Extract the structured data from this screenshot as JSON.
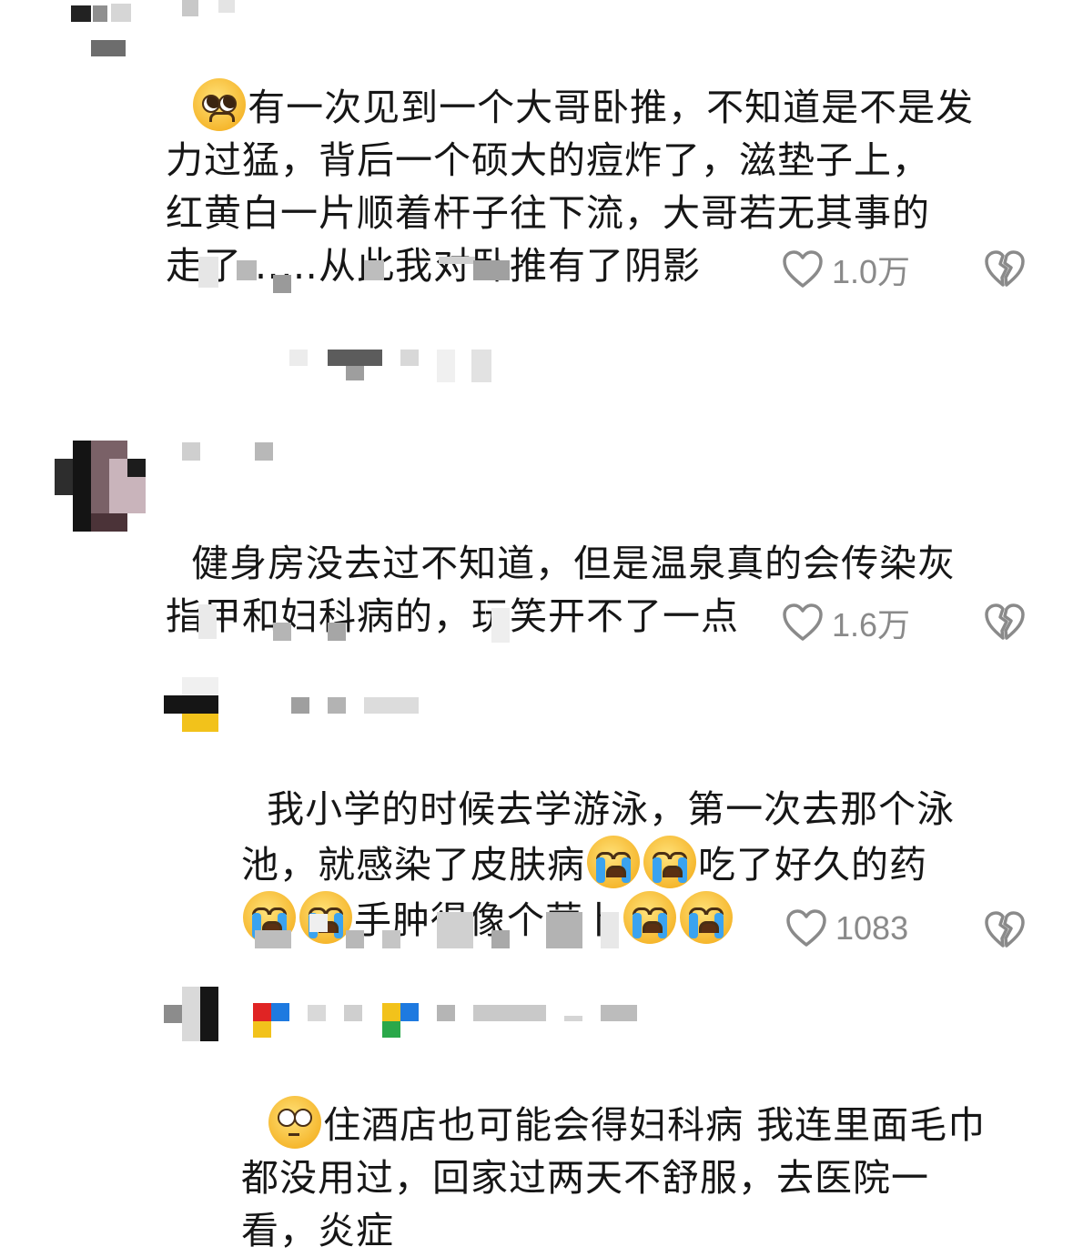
{
  "comments": [
    {
      "text_parts": [
        "有一次见到一个大哥卧推，不知道是不是发",
        "力过猛，背后一个硕大的痘炸了，滋垫子上，",
        "红黄白一片顺着杆子往下流，大哥若无其事的",
        "走了……从此我对卧推有了阴影"
      ],
      "leading_emoji": "pleading-face-icon",
      "likes": "1.0万"
    },
    {
      "text_parts": [
        "健身房没去过不知道，但是温泉真的会传染灰",
        "指甲和妇科病的，玩笑开不了一点"
      ],
      "likes": "1.6万"
    },
    {
      "line1": "我小学的时候去学游泳，第一次去那个泳",
      "line2_a": "池，就感染了皮肤病",
      "line2_b": "吃了好久的药",
      "line3": "手肿得像个萝卜",
      "emoji": "loudly-crying-face-icon",
      "likes": "1083"
    },
    {
      "line1": "住酒店也可能会得妇科病 我连里面毛巾",
      "line2": "都没用过，回家过两天不舒服，去医院一",
      "line3": "看，炎症",
      "leading_emoji": "flushed-face-icon"
    }
  ],
  "icons": {
    "like": "heart-outline-icon",
    "dislike": "broken-heart-icon"
  },
  "colors": {
    "text": "#161616",
    "meta": "#8a8a8a",
    "icon": "#8a8a8a",
    "crying_tear": "#3aa3f0"
  }
}
